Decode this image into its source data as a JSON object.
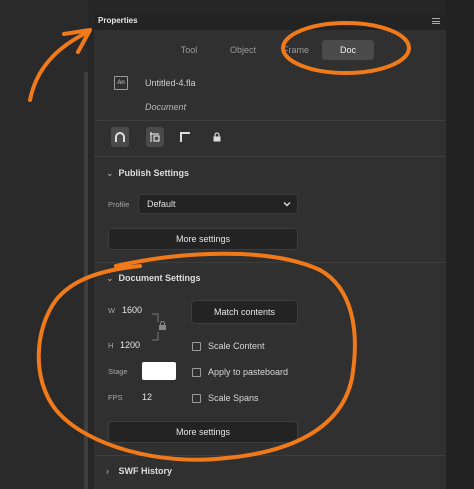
{
  "panel": {
    "title": "Properties",
    "menu_icon": "hamburger-icon"
  },
  "tabs": [
    {
      "label": "Tool",
      "active": false
    },
    {
      "label": "Object",
      "active": false
    },
    {
      "label": "Frame",
      "active": false
    },
    {
      "label": "Doc",
      "active": true
    }
  ],
  "file": {
    "icon_text": "An",
    "name": "Untitled-4.fla",
    "type": "Document"
  },
  "toolbar": {
    "icons": [
      "magnet-icon",
      "snap-to-grid-icon",
      "corner-icon",
      "lock-icon"
    ]
  },
  "publish": {
    "header": "Publish Settings",
    "profile_label": "Profile",
    "profile_value": "Default",
    "more_settings": "More settings"
  },
  "document": {
    "header": "Document Settings",
    "w_label": "W",
    "w_value": "1600",
    "h_label": "H",
    "h_value": "1200",
    "match_contents": "Match contents",
    "stage_label": "Stage",
    "stage_color": "#ffffff",
    "fps_label": "FPS",
    "fps_value": "12",
    "checkboxes": [
      "Scale Content",
      "Apply to pasteboard",
      "Scale Spans"
    ],
    "more_settings": "More settings"
  },
  "swf": {
    "header": "SWF History"
  },
  "annotation": {
    "color": "#f07a1a"
  }
}
